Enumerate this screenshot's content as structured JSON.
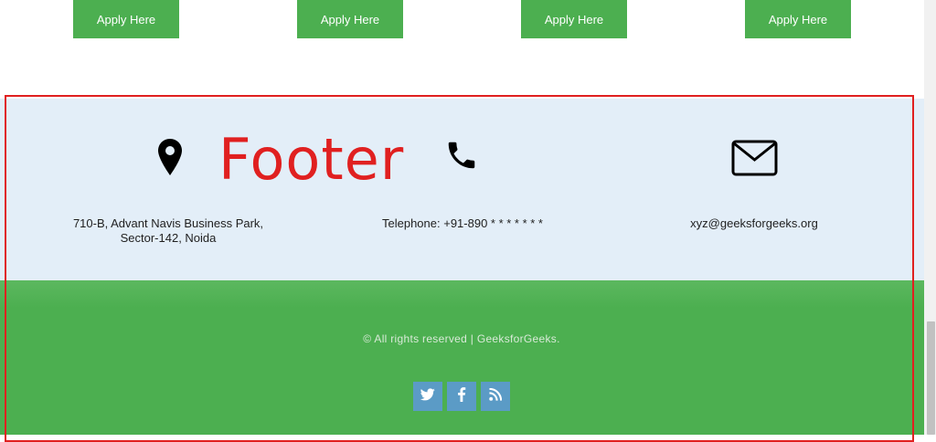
{
  "apply_buttons": [
    "Apply Here",
    "Apply Here",
    "Apply Here",
    "Apply Here"
  ],
  "contact": {
    "address_line1": "710-B, Advant Navis Business Park,",
    "address_line2": "Sector-142, Noida",
    "telephone": "Telephone: +91-890 * * * * * * *",
    "email": "xyz@geeksforgeeks.org",
    "icons": [
      "map-pin-icon",
      "phone-icon",
      "envelope-icon"
    ]
  },
  "annotation": {
    "label": "Footer",
    "color": "#e02020"
  },
  "footer": {
    "copyright": "© All rights reserved | GeeksforGeeks.",
    "social_icons": [
      "twitter-icon",
      "facebook-icon",
      "rss-icon"
    ]
  },
  "colors": {
    "button_green": "#4caf50",
    "contact_background": "#e3eef8",
    "footer_green": "#4caf50",
    "social_blue": "#5b9bc6"
  }
}
